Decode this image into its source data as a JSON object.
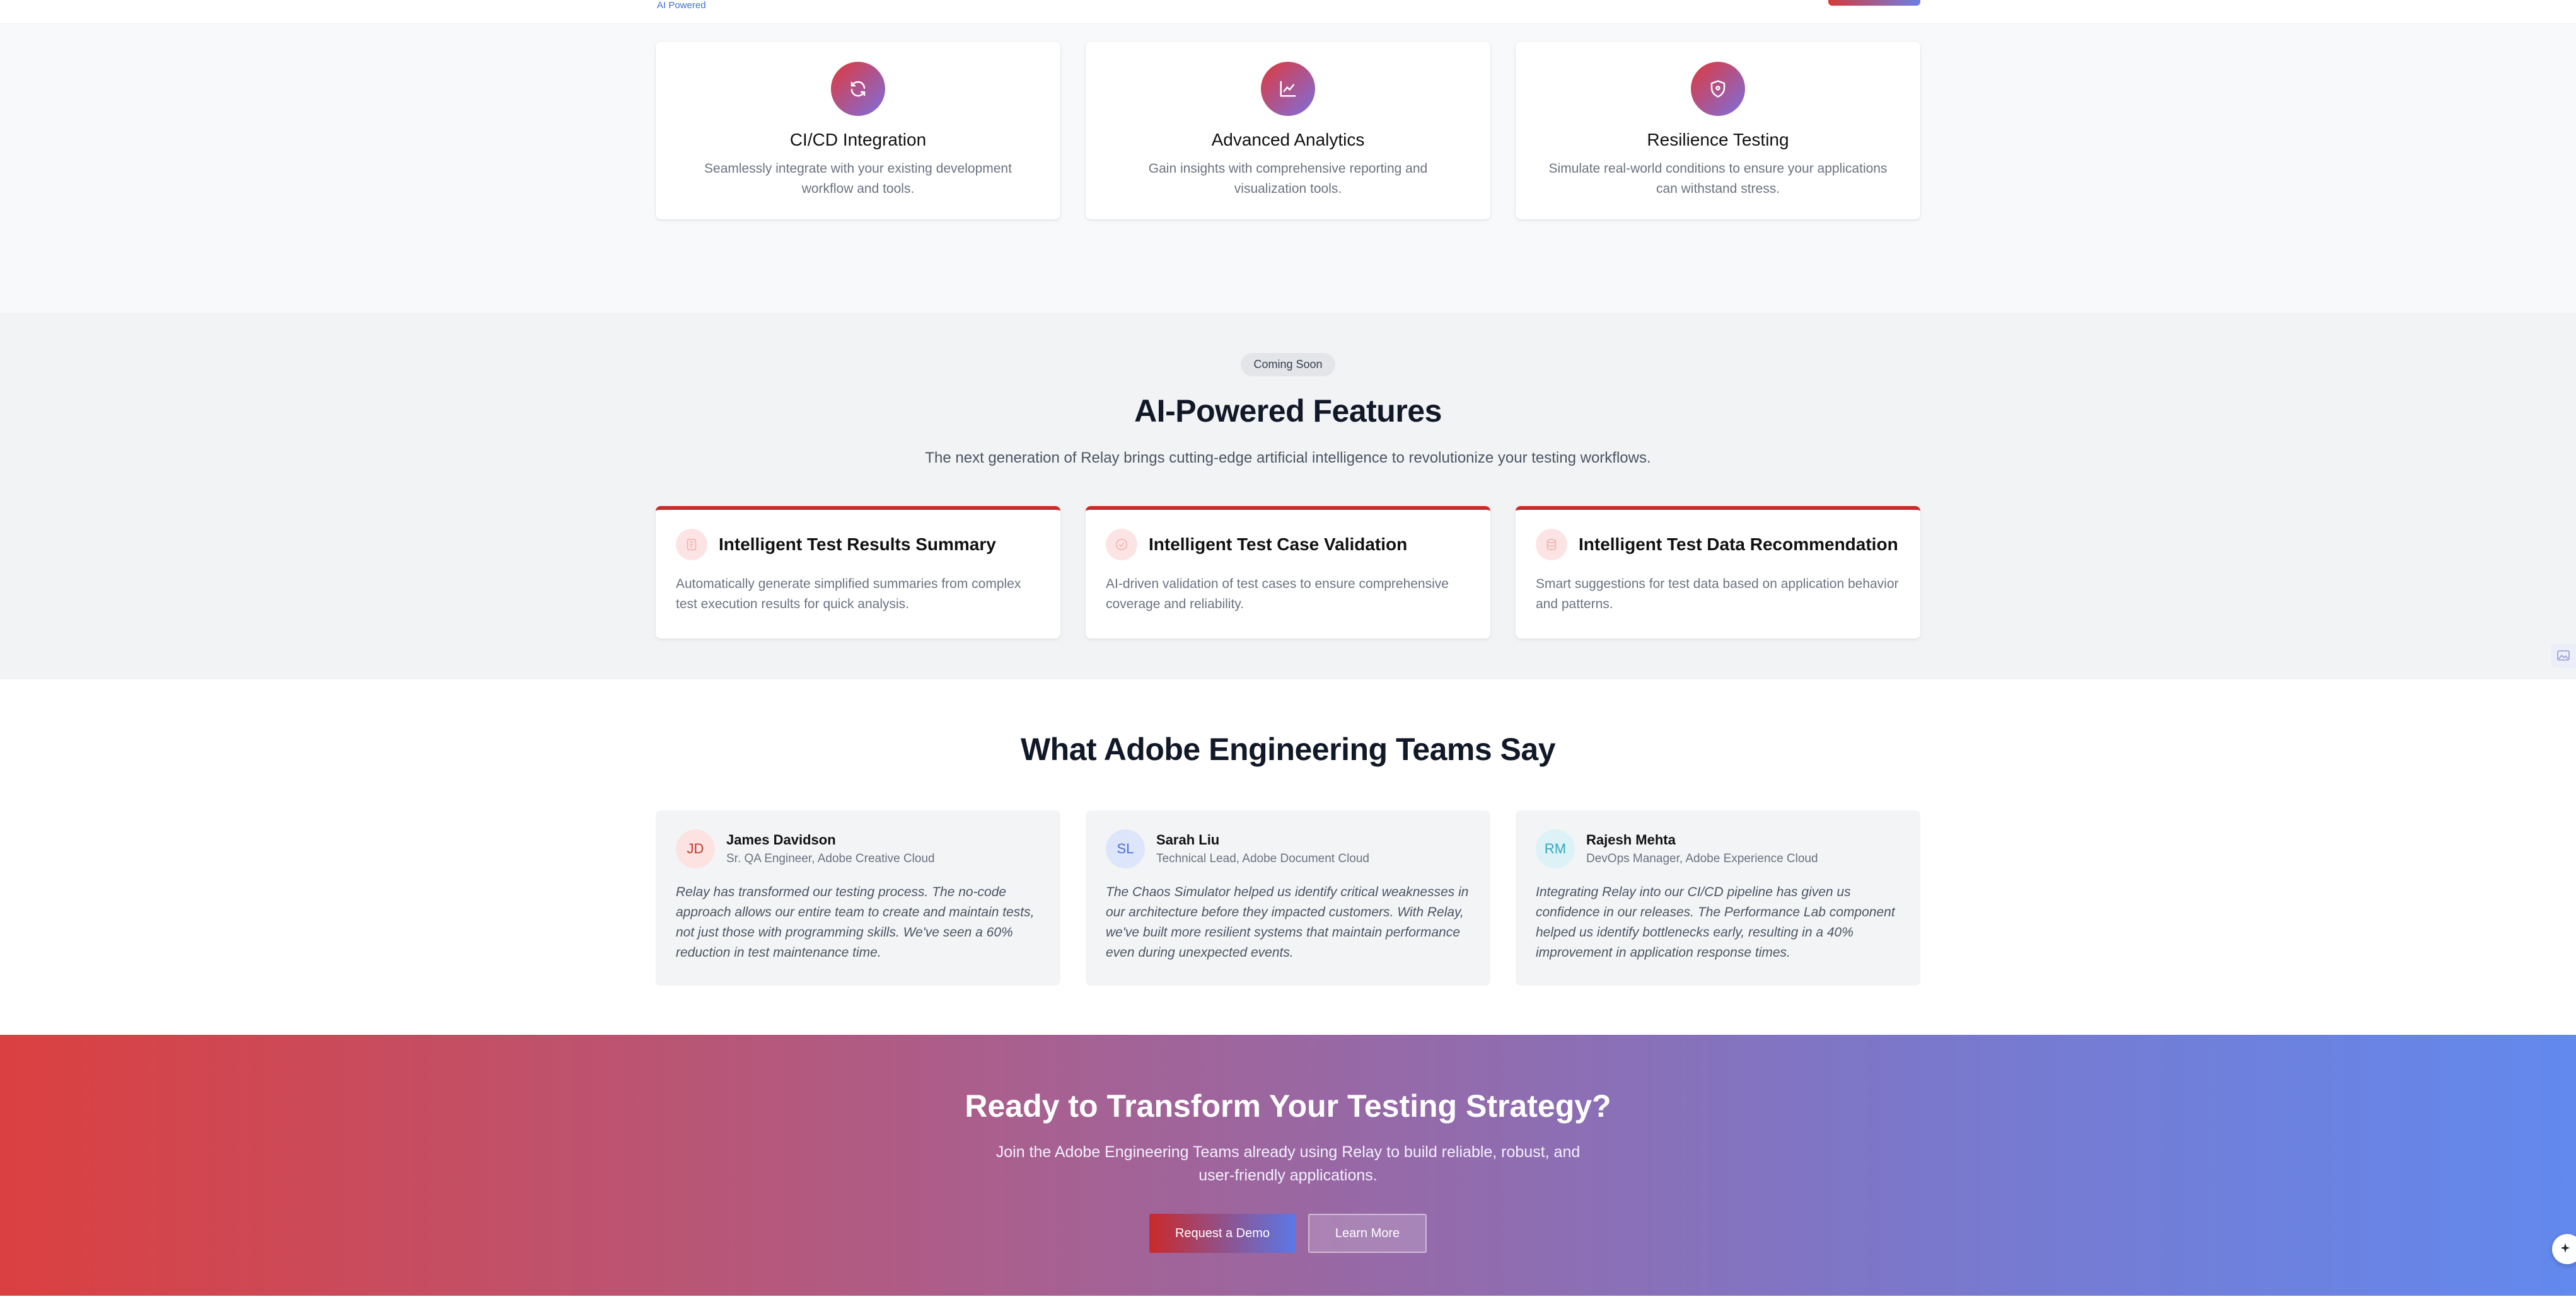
{
  "topbar": {
    "ai_powered_label": "AI Powered"
  },
  "features": {
    "cards": [
      {
        "icon": "refresh-icon",
        "title": "CI/CD Integration",
        "desc": "Seamlessly integrate with your existing development workflow and tools."
      },
      {
        "icon": "chart-line-icon",
        "title": "Advanced Analytics",
        "desc": "Gain insights with comprehensive reporting and visualization tools."
      },
      {
        "icon": "shield-icon",
        "title": "Resilience Testing",
        "desc": "Simulate real-world conditions to ensure your applications can withstand stress."
      }
    ]
  },
  "ai_section": {
    "badge": "Coming Soon",
    "title": "AI-Powered Features",
    "subtitle": "The next generation of Relay brings cutting-edge artificial intelligence to revolutionize your testing workflows.",
    "cards": [
      {
        "icon": "document-icon",
        "title": "Intelligent Test Results Summary",
        "desc": "Automatically generate simplified summaries from complex test execution results for quick analysis."
      },
      {
        "icon": "check-circle-icon",
        "title": "Intelligent Test Case Validation",
        "desc": "AI-driven validation of test cases to ensure comprehensive coverage and reliability."
      },
      {
        "icon": "database-icon",
        "title": "Intelligent Test Data Recommendation",
        "desc": "Smart suggestions for test data based on application behavior and patterns."
      }
    ]
  },
  "testimonials": {
    "title": "What Adobe Engineering Teams Say",
    "items": [
      {
        "initials": "JD",
        "name": "James Davidson",
        "role": "Sr. QA Engineer, Adobe Creative Cloud",
        "quote": "Relay has transformed our testing process. The no-code approach allows our entire team to create and maintain tests, not just those with programming skills. We've seen a 60% reduction in test maintenance time.",
        "avatar_bg": "#fde2e2",
        "avatar_fg": "#c0392b"
      },
      {
        "initials": "SL",
        "name": "Sarah Liu",
        "role": "Technical Lead, Adobe Document Cloud",
        "quote": "The Chaos Simulator helped us identify critical weaknesses in our architecture before they impacted customers. With Relay, we've built more resilient systems that maintain performance even during unexpected events.",
        "avatar_bg": "#dde5fb",
        "avatar_fg": "#4a6fd6"
      },
      {
        "initials": "RM",
        "name": "Rajesh Mehta",
        "role": "DevOps Manager, Adobe Experience Cloud",
        "quote": "Integrating Relay into our CI/CD pipeline has given us confidence in our releases. The Performance Lab component helped us identify bottlenecks early, resulting in a 40% improvement in application response times.",
        "avatar_bg": "#dcf2f6",
        "avatar_fg": "#3aa5bd"
      }
    ]
  },
  "cta": {
    "title": "Ready to Transform Your Testing Strategy?",
    "subtitle": "Join the Adobe Engineering Teams already using Relay to build reliable, robust, and user-friendly applications.",
    "primary_button": "Request a Demo",
    "secondary_button": "Learn More"
  },
  "colors": {
    "brand_red": "#c92a2a",
    "brand_blue": "#6289ee",
    "section_bg": "#f8f9fb"
  }
}
